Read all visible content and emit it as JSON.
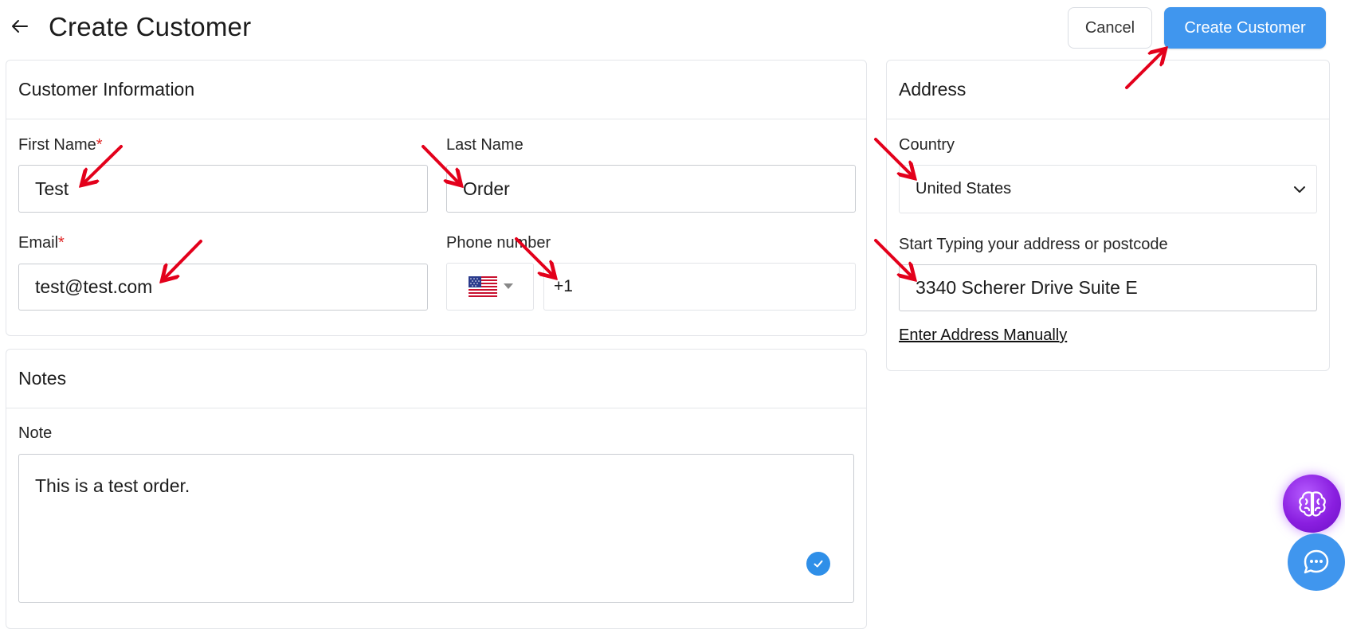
{
  "header": {
    "title": "Create Customer",
    "cancel_label": "Cancel",
    "create_label": "Create Customer"
  },
  "customer_info": {
    "title": "Customer Information",
    "first_name": {
      "label": "First Name",
      "required_mark": "*",
      "value": "Test"
    },
    "last_name": {
      "label": "Last Name",
      "value": "Order"
    },
    "email": {
      "label": "Email",
      "required_mark": "*",
      "value": "test@test.com"
    },
    "phone": {
      "label": "Phone number",
      "country_flag": "us-flag-icon",
      "value": "+1"
    }
  },
  "notes": {
    "title": "Notes",
    "note_label": "Note",
    "note_value": "This is a test order."
  },
  "address": {
    "title": "Address",
    "country_label": "Country",
    "country_value": "United States",
    "search_label": "Start Typing your address or postcode",
    "search_value": "3340 Scherer Drive Suite E",
    "manual_link": "Enter Address Manually"
  },
  "colors": {
    "primary": "#4096ee",
    "required": "#e02424",
    "annotation_arrow": "#e3001b",
    "ai_fab": "#8a1fe0"
  },
  "icons": {
    "back": "arrow-left-icon",
    "country_caret": "chevron-down-icon",
    "flag_caret": "caret-down-icon",
    "note_check": "check-icon",
    "ai": "brain-icon",
    "chat": "chat-bubble-icon"
  }
}
